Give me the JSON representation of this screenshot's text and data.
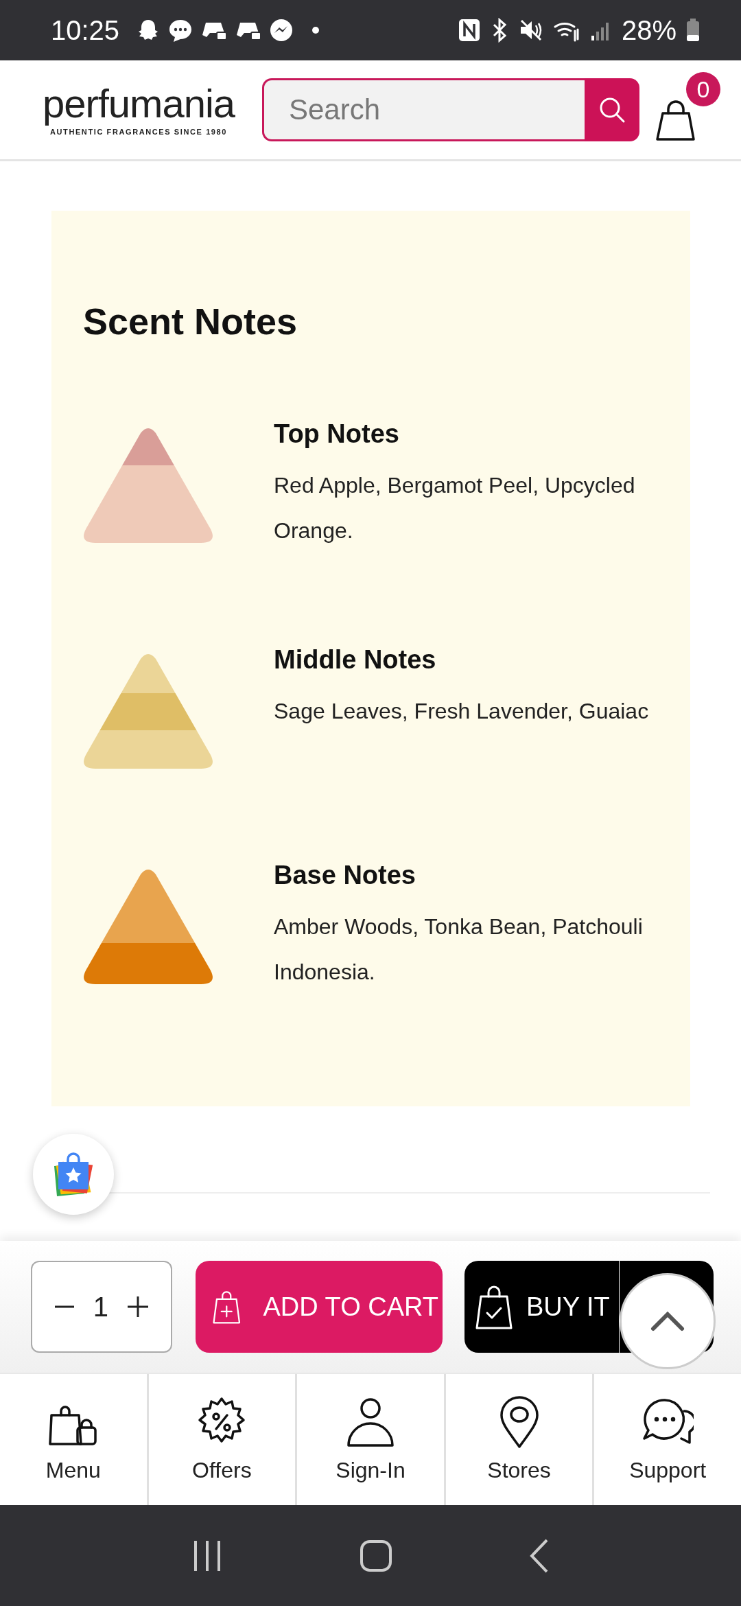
{
  "status_bar": {
    "time": "10:25",
    "battery": "28%"
  },
  "header": {
    "logo": "perfumania",
    "tagline": "AUTHENTIC FRAGRANCES SINCE 1980",
    "search": {
      "placeholder": "Search"
    },
    "cart_count": "0"
  },
  "scent_notes": {
    "title": "Scent Notes",
    "notes": [
      {
        "kind": "top",
        "title": "Top Notes",
        "description": "Red Apple, Bergamot Peel, Upcycled Orange."
      },
      {
        "kind": "middle",
        "title": "Middle Notes",
        "description": "Sage Leaves, Fresh Lavender, Guaiac"
      },
      {
        "kind": "base",
        "title": "Base Notes",
        "description": "Amber Woods, Tonka Bean, Patchouli Indonesia."
      }
    ]
  },
  "purchase_bar": {
    "quantity": "1",
    "add_to_cart": "ADD TO CART",
    "buy_now": "BUY IT"
  },
  "bottom_nav": [
    {
      "kind": "menu",
      "label": "Menu"
    },
    {
      "kind": "offers",
      "label": "Offers"
    },
    {
      "kind": "signin",
      "label": "Sign-In"
    },
    {
      "kind": "stores",
      "label": "Stores"
    },
    {
      "kind": "support",
      "label": "Support"
    }
  ]
}
